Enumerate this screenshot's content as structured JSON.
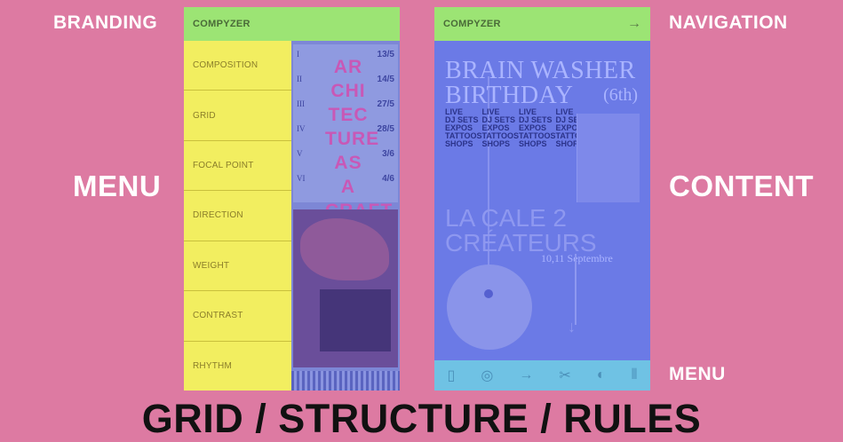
{
  "labels": {
    "branding": "BRANDING",
    "navigation": "NAVIGATION",
    "menu_left": "MENU",
    "content": "CONTENT",
    "menu_bottom": "MENU",
    "caption": "GRID / STRUCTURE / RULES"
  },
  "left_phone": {
    "brand": "COMPYZER",
    "menu_items": [
      {
        "label": "COMPOSITION"
      },
      {
        "label": "GRID"
      },
      {
        "label": "FOCAL POINT"
      },
      {
        "label": "DIRECTION"
      },
      {
        "label": "WEIGHT"
      },
      {
        "label": "CONTRAST"
      },
      {
        "label": "RHYTHM"
      }
    ],
    "poster": {
      "numerals": [
        "I",
        "II",
        "III",
        "IV",
        "V",
        "VI"
      ],
      "dates": [
        "13/5",
        "14/5",
        "27/5",
        "28/5",
        "3/6",
        "4/6"
      ],
      "title_lines": [
        "AR",
        "CHI",
        "TEC",
        "TURE",
        "AS A",
        "CRAFT"
      ]
    }
  },
  "right_phone": {
    "brand": "COMPYZER",
    "nav_icon": "arrow-right-icon",
    "title_line1": "BRAIN WASHER",
    "title_line2": "BIRTHDAY",
    "edition": "(6th)",
    "columns": [
      [
        "LIVE",
        "DJ SETS",
        "EXPOS",
        "TATTOOS",
        "SHOPS"
      ],
      [
        "LIVE",
        "DJ SETS",
        "EXPOS",
        "TATTOOS",
        "SHOPS"
      ],
      [
        "LIVE",
        "DJ SETS",
        "EXPOS",
        "TATTOOS",
        "SHOPS"
      ],
      [
        "LIVE",
        "DJ SETS",
        "EXPOS",
        "TATTOOS",
        "SHOPS"
      ]
    ],
    "title2_line1": "LA CALE 2",
    "title2_line2": "CRÉATEURS",
    "date_text": "10,11 Septembre",
    "bottom_icons": [
      "phone-icon",
      "eye-icon",
      "arrow-right-icon",
      "scissors-icon",
      "contrast-icon",
      "bars-icon"
    ]
  },
  "colors": {
    "background": "#dd7aa2",
    "topbar": "#9ce474",
    "menu": "#f2ee60",
    "content": "#6b7ae6",
    "bottombar": "#6fc2e4"
  }
}
